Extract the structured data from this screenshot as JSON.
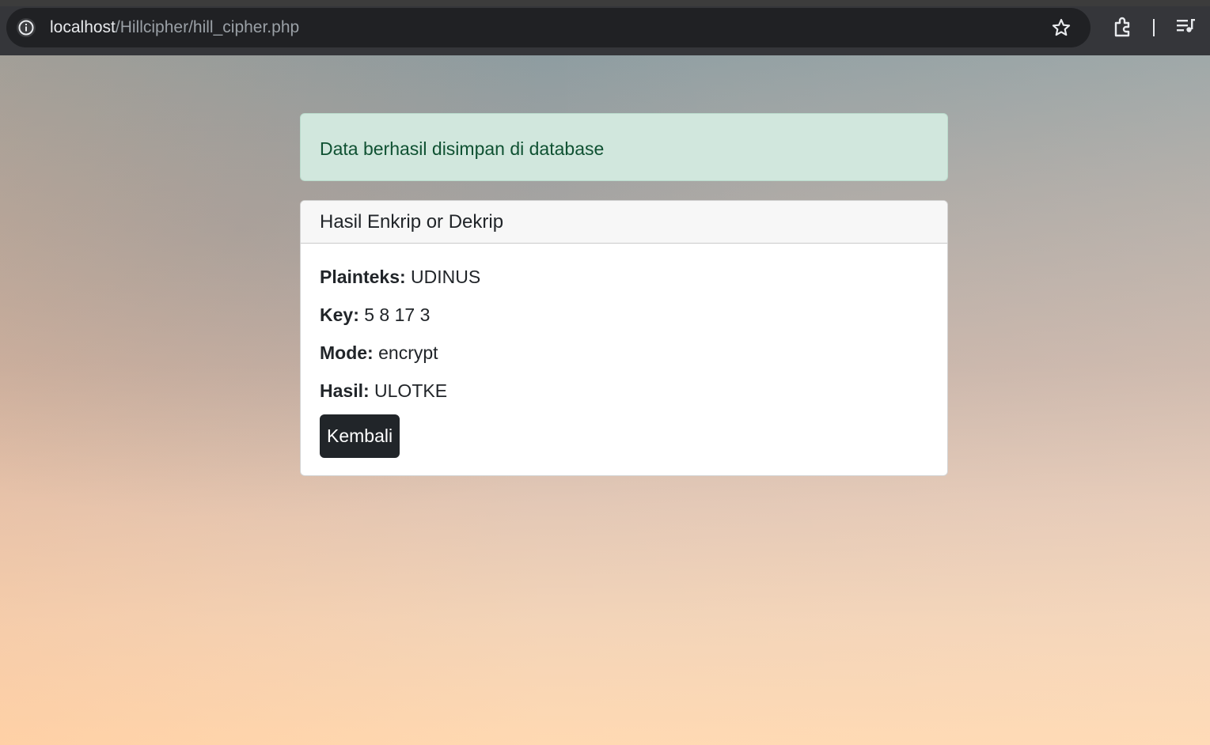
{
  "browser": {
    "url_host": "localhost",
    "url_path": "/Hillcipher/hill_cipher.php"
  },
  "alert": {
    "message": "Data berhasil disimpan di database",
    "color": "#d1e7dd"
  },
  "card": {
    "title": "Hasil Enkrip or Dekrip",
    "fields": [
      {
        "label": "Plainteks:",
        "value": "UDINUS"
      },
      {
        "label": "Key:",
        "value": "5 8 17 3"
      },
      {
        "label": "Mode:",
        "value": "encrypt"
      },
      {
        "label": "Hasil:",
        "value": "ULOTKE"
      }
    ],
    "back_label": "Kembali"
  },
  "icons": {
    "info": "info-icon",
    "star": "star-icon",
    "extensions": "extensions-icon",
    "media": "media-playlist-icon"
  }
}
